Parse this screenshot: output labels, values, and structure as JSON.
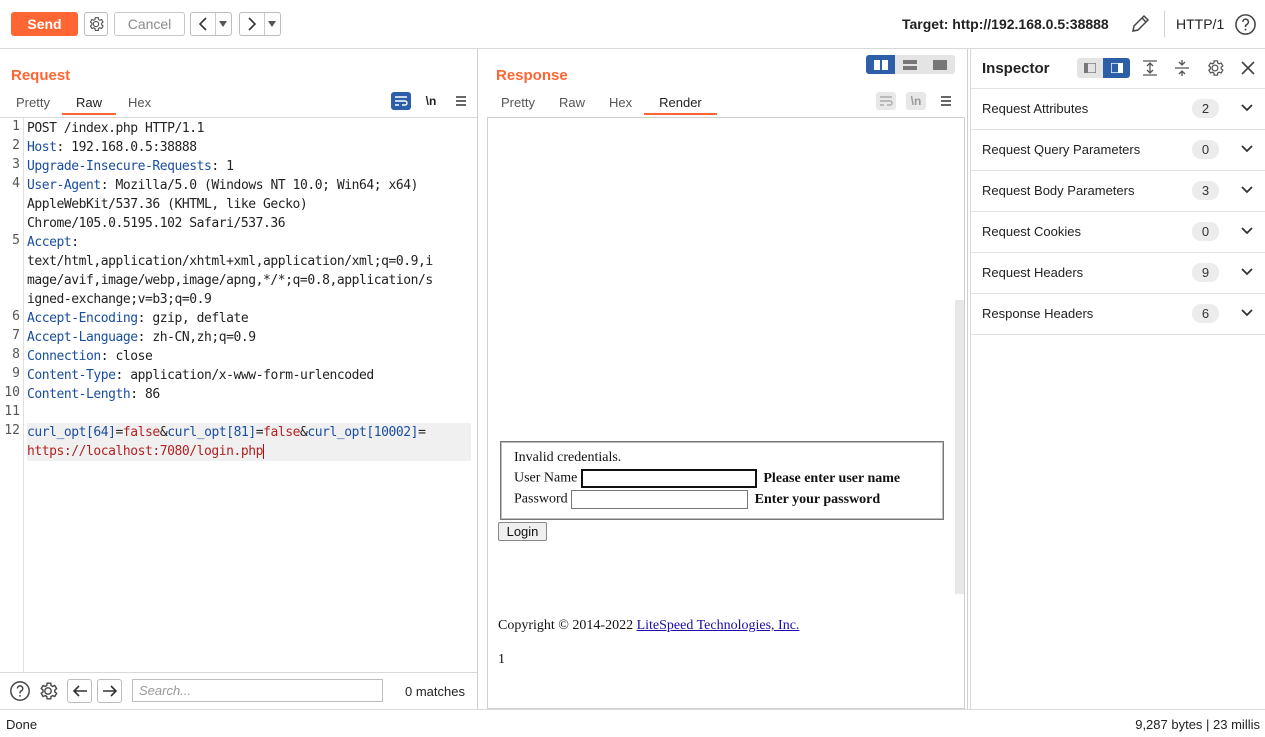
{
  "toolbar": {
    "send_label": "Send",
    "cancel_label": "Cancel",
    "target_label": "Target: http://192.168.0.5:38888",
    "http_version": "HTTP/1"
  },
  "request": {
    "title": "Request",
    "tabs": [
      {
        "label": "Pretty"
      },
      {
        "label": "Raw"
      },
      {
        "label": "Hex"
      }
    ],
    "active_tab": "Raw",
    "newline_toggle": "\\n",
    "lines": [
      {
        "num": "1",
        "text": "POST /index.php HTTP/1.1"
      },
      {
        "num": "2",
        "key": "Host",
        "value": ": 192.168.0.5:38888"
      },
      {
        "num": "3",
        "key": "Upgrade-Insecure-Requests",
        "value": ": 1"
      },
      {
        "num": "4",
        "key": "User-Agent",
        "value": ": Mozilla/5.0 (Windows NT 10.0; Win64; x64)"
      },
      {
        "num": "",
        "text": "AppleWebKit/537.36 (KHTML, like Gecko)"
      },
      {
        "num": "",
        "text": "Chrome/105.0.5195.102 Safari/537.36"
      },
      {
        "num": "5",
        "key": "Accept",
        "value": ":"
      },
      {
        "num": "",
        "text": "text/html,application/xhtml+xml,application/xml;q=0.9,i"
      },
      {
        "num": "",
        "text": "mage/avif,image/webp,image/apng,*/*;q=0.8,application/s"
      },
      {
        "num": "",
        "text": "igned-exchange;v=b3;q=0.9"
      },
      {
        "num": "6",
        "key": "Accept-Encoding",
        "value": ": gzip, deflate"
      },
      {
        "num": "7",
        "key": "Accept-Language",
        "value": ": zh-CN,zh;q=0.9"
      },
      {
        "num": "8",
        "key": "Connection",
        "value": ": close"
      },
      {
        "num": "9",
        "key": "Content-Type",
        "value": ": application/x-www-form-urlencoded"
      },
      {
        "num": "10",
        "key": "Content-Length",
        "value": ": 86"
      },
      {
        "num": "11",
        "text": ""
      }
    ],
    "body_line_num": "12",
    "body": {
      "p1_key": "curl_opt[64]",
      "p1_val": "false",
      "p2_key": "curl_opt[81]",
      "p2_val": "false",
      "p3_key": "curl_opt[10002]",
      "p3_val": "https://localhost:7080/login.php",
      "eq": "=",
      "amp": "&"
    },
    "search_placeholder": "Search...",
    "matches": "0 matches"
  },
  "response": {
    "title": "Response",
    "tabs": [
      {
        "label": "Pretty"
      },
      {
        "label": "Raw"
      },
      {
        "label": "Hex"
      },
      {
        "label": "Render"
      }
    ],
    "active_tab": "Render",
    "newline_toggle": "\\n",
    "render": {
      "message": "Invalid credentials.",
      "user_label": "User Name",
      "user_hint": "Please enter user name",
      "pass_label": "Password",
      "pass_hint": "Enter your password",
      "login_button": "Login",
      "copyright_prefix": "Copyright © 2014-2022 ",
      "copyright_link": "LiteSpeed Technologies, Inc.",
      "trailing_text": "1"
    }
  },
  "inspector": {
    "title": "Inspector",
    "sections": [
      {
        "label": "Request Attributes",
        "count": "2"
      },
      {
        "label": "Request Query Parameters",
        "count": "0"
      },
      {
        "label": "Request Body Parameters",
        "count": "3"
      },
      {
        "label": "Request Cookies",
        "count": "0"
      },
      {
        "label": "Request Headers",
        "count": "9"
      },
      {
        "label": "Response Headers",
        "count": "6"
      }
    ]
  },
  "status": {
    "left": "Done",
    "right": "9,287 bytes | 23 millis"
  },
  "colors": {
    "accent": "#ff6633",
    "header_key": "#1a4ea1",
    "param_value": "#b22222",
    "active_toggle": "#2c5fa8"
  }
}
